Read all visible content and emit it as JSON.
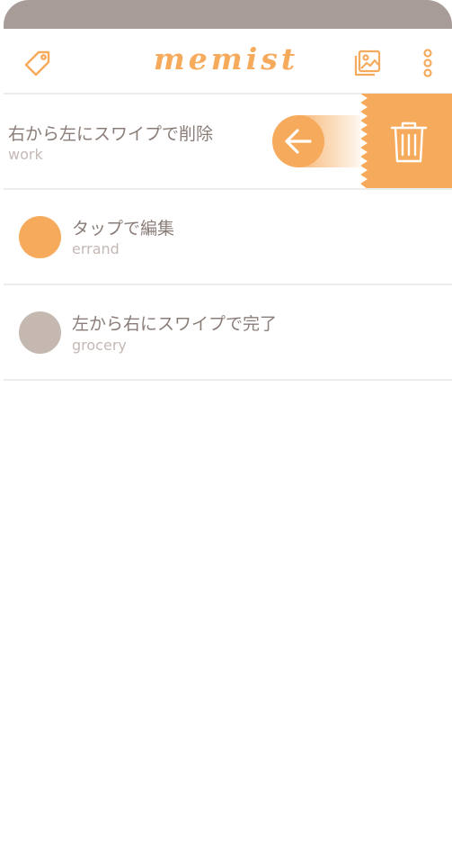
{
  "app": {
    "logo_text": "memist"
  },
  "colors": {
    "accent": "#f6aa5c",
    "text": "#8a7d78",
    "subtext": "#c4b9b5",
    "statusbar": "#a89c98",
    "muted_dot": "#c4b8b0"
  },
  "toolbar": {
    "left_icon": "tag-icon",
    "right_icons": [
      "image-gallery-icon",
      "more-vertical-icon"
    ]
  },
  "memos": [
    {
      "title": "右から左にスワイプで削除",
      "category": "work",
      "dot_color": "#f6aa5c"
    },
    {
      "title": "タップで編集",
      "category": "errand",
      "dot_color": "#f6aa5c"
    },
    {
      "title": "左から右にスワイプで完了",
      "category": "grocery",
      "dot_color": "#c4b8b0"
    }
  ],
  "swipe_actions": {
    "delete_icon": "trash-icon",
    "swipe_indicator_icon": "arrow-left-icon"
  }
}
